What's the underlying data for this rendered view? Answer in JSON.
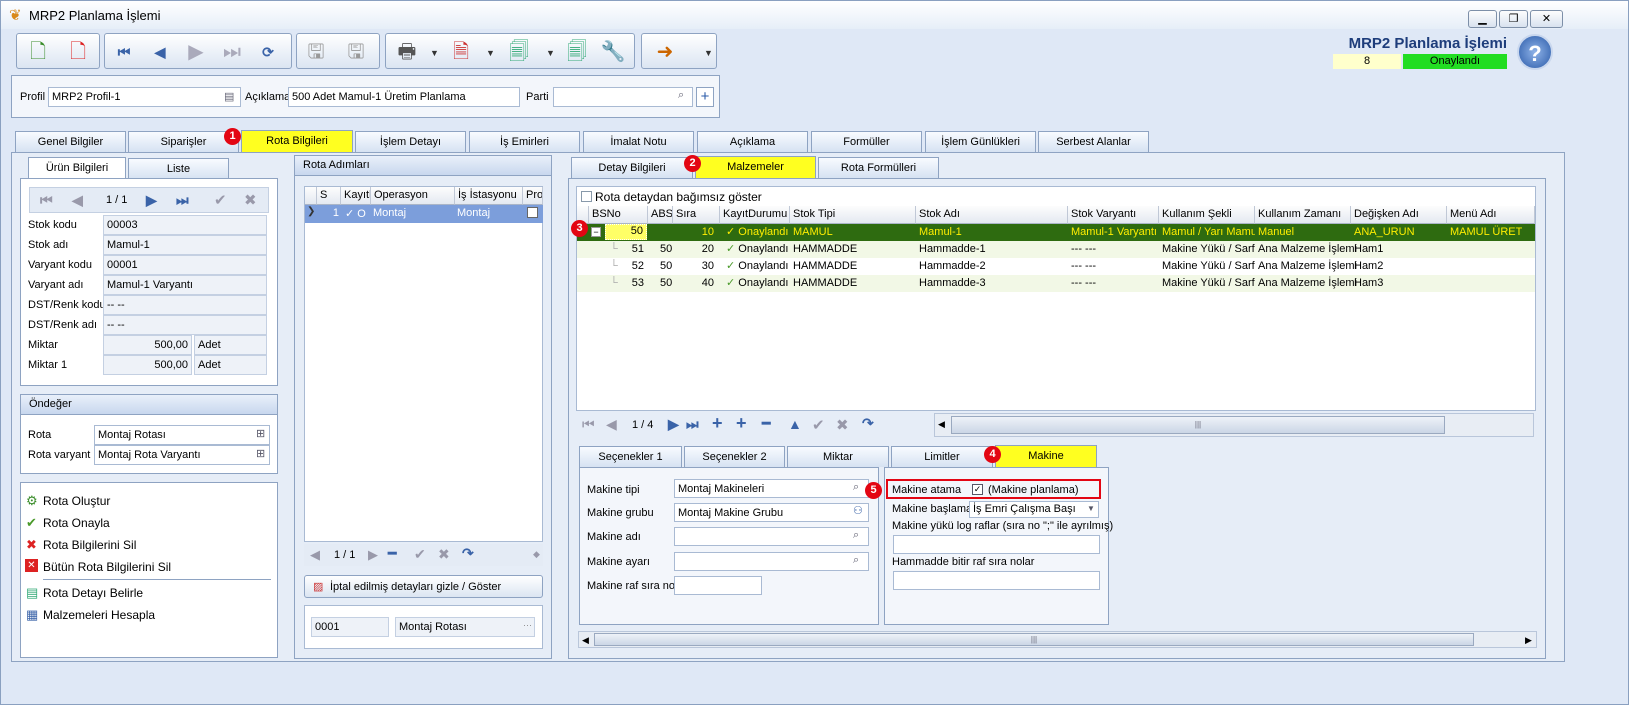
{
  "window": {
    "title": "MRP2 Planlama İşlemi",
    "controls": [
      "▁",
      "❐",
      "✕"
    ]
  },
  "header": {
    "title": "MRP2 Planlama İşlemi",
    "number": "8",
    "status": "Onaylandı",
    "help": "?"
  },
  "filter": {
    "profil_label": "Profil",
    "profil_value": "MRP2 Profil-1",
    "aciklama_label": "Açıklama",
    "aciklama_value": "500 Adet Mamul-1 Üretim Planlama",
    "parti_label": "Parti",
    "parti_value": ""
  },
  "main_tabs": [
    "Genel Bilgiler",
    "Siparişler",
    "Rota Bilgileri",
    "İşlem Detayı",
    "İş Emirleri",
    "İmalat Notu",
    "Açıklama",
    "Formüller",
    "İşlem Günlükleri",
    "Serbest Alanlar"
  ],
  "badges": [
    "1",
    "2",
    "3",
    "4",
    "5"
  ],
  "left": {
    "tabs": [
      "Ürün Bilgileri",
      "Liste"
    ],
    "pager": "1 / 1",
    "fields": [
      {
        "label": "Stok kodu",
        "value": "00003"
      },
      {
        "label": "Stok adı",
        "value": "Mamul-1"
      },
      {
        "label": "Varyant kodu",
        "value": "00001"
      },
      {
        "label": "Varyant adı",
        "value": "Mamul-1 Varyantı"
      },
      {
        "label": "DST/Renk kodu",
        "value": "-- --"
      },
      {
        "label": "DST/Renk adı",
        "value": "-- --"
      }
    ],
    "miktar_label": "Miktar",
    "miktar_value": "500,00",
    "miktar_unit": "Adet",
    "miktar1_label": "Miktar 1",
    "miktar1_value": "500,00",
    "miktar1_unit": "Adet",
    "ondeger_title": "Öndeğer",
    "rota_label": "Rota",
    "rota_value": "Montaj Rotası",
    "rota_varyant_label": "Rota varyant",
    "rota_varyant_value": "Montaj Rota Varyantı",
    "actions": [
      "Rota Oluştur",
      "Rota Onayla",
      "Rota Bilgilerini Sil",
      "Bütün Rota Bilgilerini Sil",
      "Rota Detayı Belirle",
      "Malzemeleri Hesapla"
    ]
  },
  "rota_adimlari": {
    "title": "Rota Adımları",
    "columns": [
      "S",
      "Kayıtl",
      "Operasyon",
      "İş İstasyonu",
      "Pro"
    ],
    "row": {
      "s": "1",
      "kayit": "✓ O",
      "operasyon": "Montaj",
      "istasyon": "Montaj"
    },
    "pager": "1 / 1",
    "iptal_button": "İptal edilmiş detayları gizle / Göster",
    "code": "0001",
    "name": "Montaj Rotası"
  },
  "right_tabs": [
    "Detay Bilgileri",
    "Malzemeler",
    "Rota Formülleri"
  ],
  "malzemeler": {
    "checkbox_label": "Rota detaydan bağımsız göster",
    "columns": [
      "BSNo",
      "ABSI",
      "Sıra",
      "KayıtDurumu",
      "Stok Tipi",
      "Stok Adı",
      "Stok Varyantı",
      "Kullanım Şekli",
      "Kullanım Zamanı",
      "Değişken Adı",
      "Menü Adı"
    ],
    "rows": [
      {
        "bsno": "50",
        "absi": "",
        "sira": "10",
        "durum": "Onaylandı",
        "tip": "MAMUL",
        "adi": "Mamul-1",
        "varyant": "Mamul-1 Varyantı",
        "sekil": "Mamul / Yarı Mamul",
        "zaman": "Manuel",
        "degisken": "ANA_URUN",
        "menu": "MAMUL ÜRET"
      },
      {
        "bsno": "51",
        "absi": "50",
        "sira": "20",
        "durum": "Onaylandı",
        "tip": "HAMMADDE",
        "adi": "Hammadde-1",
        "varyant": "--- ---",
        "sekil": "Makine Yükü / Sarf",
        "zaman": "Ana Malzeme İşlemi",
        "degisken": "Ham1",
        "menu": ""
      },
      {
        "bsno": "52",
        "absi": "50",
        "sira": "30",
        "durum": "Onaylandı",
        "tip": "HAMMADDE",
        "adi": "Hammadde-2",
        "varyant": "--- ---",
        "sekil": "Makine Yükü / Sarf",
        "zaman": "Ana Malzeme İşlemi",
        "degisken": "Ham2",
        "menu": ""
      },
      {
        "bsno": "53",
        "absi": "50",
        "sira": "40",
        "durum": "Onaylandı",
        "tip": "HAMMADDE",
        "adi": "Hammadde-3",
        "varyant": "--- ---",
        "sekil": "Makine Yükü / Sarf",
        "zaman": "Ana Malzeme İşlemi",
        "degisken": "Ham3",
        "menu": ""
      }
    ],
    "pager": "1 / 4"
  },
  "sub_tabs": [
    "Seçenekler 1",
    "Seçenekler 2",
    "Miktar",
    "Limitler",
    "Makine"
  ],
  "makine": {
    "tipi_label": "Makine tipi",
    "tipi_value": "Montaj Makineleri",
    "grubu_label": "Makine grubu",
    "grubu_value": "Montaj Makine Grubu",
    "adi_label": "Makine adı",
    "ayari_label": "Makine ayarı",
    "raf_label": "Makine raf sıra no",
    "atama_label": "Makine atama",
    "atama_text": "(Makine planlama)",
    "baslama_label": "Makine başlama",
    "baslama_value": "İş Emri Çalışma Başı",
    "log_label": "Makine yükü log raflar (sıra no \";\" ile ayrılmış)",
    "bitir_label": "Hammadde bitir raf sıra nolar"
  }
}
